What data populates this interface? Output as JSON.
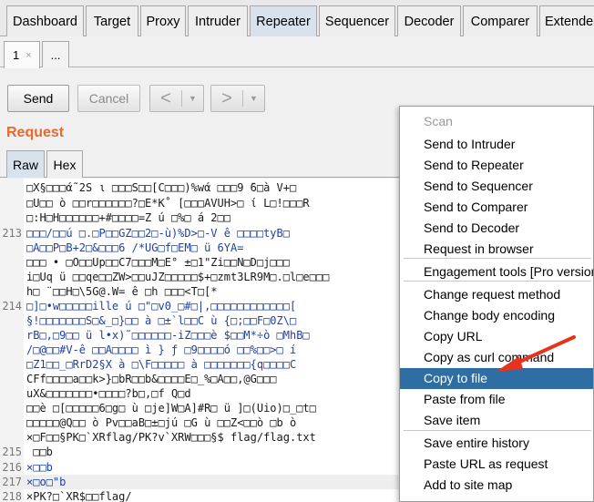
{
  "main_tabs": [
    "Dashboard",
    "Target",
    "Proxy",
    "Intruder",
    "Repeater",
    "Sequencer",
    "Decoder",
    "Comparer",
    "Extender"
  ],
  "sub_tabs": {
    "first": "1",
    "close": "×",
    "more": "..."
  },
  "toolbar": {
    "send": "Send",
    "cancel": "Cancel",
    "back": "<",
    "forward": ">",
    "caret": "▼"
  },
  "request": {
    "title": "Request",
    "tabs": [
      "Raw",
      "Hex"
    ]
  },
  "editor": {
    "lines": [
      {
        "n": "",
        "t": "□X§□□□ά˜2S ι □□□S□□[C□□□)%wά □□□9 ̈6□à V+□",
        "c": ""
      },
      {
        "n": "",
        "t": "□U□□ ò □□r□□□□□□?□E*K˚ [□□□AVUH>□ ί L□!□□□R",
        "c": ""
      },
      {
        "n": "",
        "t": "□:H□H□□□□□□+#□□□□=Z ú □%□ á 2□□",
        "c": ""
      },
      {
        "n": "213",
        "t": "□□□/□□ú □.□P□□GZ□□2□-ù)%D>□-V ê □□□□tyB□",
        "c": "blue"
      },
      {
        "n": "",
        "t": "□A□□P□B+2□&□□□6 /*UG□f□EM□ ü 6YA=",
        "c": "blue"
      },
      {
        "n": "",
        "t": "□□□ • □O□□Up□□C7□□□M□E° ±□1\"Zi□□N□D□j□□□",
        "c": ""
      },
      {
        "n": "",
        "t": "i□Uq ü □□qe□□ZW>□□uJZ□□□□□$+□zmt3LR9M□.□l□e□□□",
        "c": ""
      },
      {
        "n": "",
        "t": "h□ ̈ □□H□\\5G@.W= ê □h □□□<T□[*",
        "c": ""
      },
      {
        "n": "214",
        "t": "□]□•w□□□□□ille ú □\"□v0_□#□|,□□□□□□□□□□□□[",
        "c": "blue"
      },
      {
        "n": "",
        "t": "§!□□□□□□□S□&_□}□□ à □±`l□□C ù {□;□□F□0Z\\□",
        "c": "blue"
      },
      {
        "n": "",
        "t": "rB□,□9□□ ü l•x)˜□□□□□□-iZ□□□è $□□M*÷ò □MhB□",
        "c": "blue"
      },
      {
        "n": "",
        "t": "/□@□□#V-ê □□A□□□□ ì } ƒ □9□□□□ó □□%□□>□ í",
        "c": "blue"
      },
      {
        "n": "",
        "t": "□Z1□□_□RrD2§X à □\\F□□□□□ à □□□□□□□{q□□□□C",
        "c": "blue"
      },
      {
        "n": "",
        "t": "CFf□□□□a□□k>}□bR□□b&□□□□E□_%□A□□,@G□□□",
        "c": ""
      },
      {
        "n": "",
        "t": "uX&□□□□□□□•□□□□?b□,□f Q□d",
        "c": ""
      },
      {
        "n": "",
        "t": "□□è □[□□□□□6□g□ ù □je]W□A]#R□ ü ]□(Uio)□_□t□",
        "c": ""
      },
      {
        "n": "",
        "t": "□□□□□@Q□□ ò Pv□□aB□±□jú □G ù □□Z<□□ò □b ò",
        "c": ""
      },
      {
        "n": "",
        "t": "×□F□□§PK□`XRflag/PK?v`XRW□□□§$ flag/flag.txt",
        "c": ""
      },
      {
        "n": "215",
        "t": " □□b",
        "c": ""
      },
      {
        "n": "216",
        "t": "×□□b",
        "c": "blue"
      },
      {
        "n": "217",
        "t": "×□o□\"b",
        "c": "blue"
      },
      {
        "n": "218",
        "t": "×PK?□`XR$□□flag/",
        "c": ""
      }
    ]
  },
  "context_menu": {
    "items": [
      "Scan",
      "Send to Intruder",
      "Send to Repeater",
      "Send to Sequencer",
      "Send to Comparer",
      "Send to Decoder",
      "Request in browser",
      "Engagement tools [Pro version only]",
      "Change request method",
      "Change body encoding",
      "Copy URL",
      "Copy as curl command",
      "Copy to file",
      "Paste from file",
      "Save item",
      "Save entire history",
      "Paste URL as request",
      "Add to site map"
    ],
    "disabled_index": 0,
    "selected_index": 12,
    "selected_color": "#2f6ea2",
    "annotation_color": "#e8321e"
  },
  "colors": {
    "accent": "#e8692a",
    "active_tab": "#d8e2ec"
  }
}
